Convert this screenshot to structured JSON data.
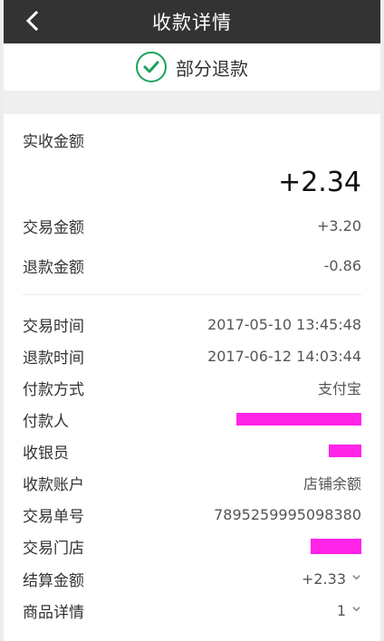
{
  "header": {
    "title": "收款详情"
  },
  "status": {
    "label": "部分退款"
  },
  "amount": {
    "received_label": "实收金额",
    "received_value": "+2.34"
  },
  "rows": [
    {
      "label": "交易金额",
      "value": "+3.20"
    },
    {
      "label": "退款金额",
      "value": "-0.86"
    },
    {
      "label": "交易时间",
      "value": "2017-05-10 13:45:48"
    },
    {
      "label": "退款时间",
      "value": "2017-06-12 14:03:44"
    },
    {
      "label": "付款方式",
      "value": "支付宝"
    },
    {
      "label": "付款人",
      "value": ""
    },
    {
      "label": "收银员",
      "value": ""
    },
    {
      "label": "收款账户",
      "value": "店铺余额"
    },
    {
      "label": "交易单号",
      "value": "7895259995098380"
    },
    {
      "label": "交易门店",
      "value": ""
    },
    {
      "label": "结算金额",
      "value": "+2.33"
    },
    {
      "label": "商品详情",
      "value": "1"
    }
  ],
  "colors": {
    "header_bg": "#333333",
    "success_green": "#1aa35a",
    "redaction_magenta": "#ff24e8"
  },
  "icons": {
    "back": "chevron-left-icon",
    "status": "check-circle-icon",
    "expand": "chevron-down-icon"
  }
}
